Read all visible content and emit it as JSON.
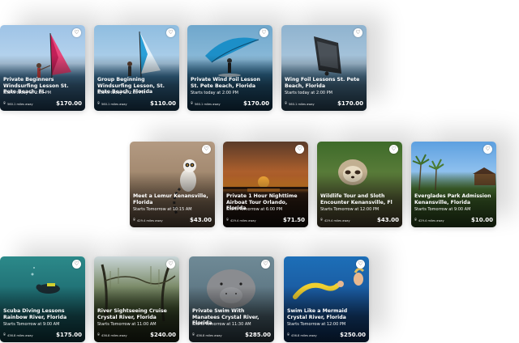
{
  "rows": [
    {
      "cards": [
        {
          "title": "Private Beginners Windsurfing Lesson St. Pete Beach, FL",
          "start": "Starts today at 2:00 PM",
          "distance": "560.1 miles away",
          "price": "$170.00",
          "image_icon": "windsurf-photo"
        },
        {
          "title": "Group Beginning Windsurfing Lesson, St. Pete Beach, Florida",
          "start": "Starts today at 2:00 PM",
          "distance": "560.1 miles away",
          "price": "$110.00",
          "image_icon": "windsurf-photo"
        },
        {
          "title": "Private Wind Foil Lesson St. Pete Beach, Florida",
          "start": "Starts today at 2:00 PM",
          "distance": "560.1 miles away",
          "price": "$170.00",
          "image_icon": "wind-foil-photo"
        },
        {
          "title": "Wing Foil Lessons St. Pete Beach, Florida",
          "start": "Starts today at 2:00 PM",
          "distance": "560.1 miles away",
          "price": "$170.00",
          "image_icon": "wing-foil-photo"
        }
      ]
    },
    {
      "cards": [
        {
          "title": "Meet a Lemur Kenansville, Florida",
          "start": "Starts Tomorrow at 10:15 AM",
          "distance": "429.4 miles away",
          "price": "$43.00",
          "image_icon": "lemur-photo"
        },
        {
          "title": "Private 1 Hour Nighttime Airboat Tour Orlando, Florida",
          "start": "Starts Tomorrow at 6:00 PM",
          "distance": "429.4 miles away",
          "price": "$71.50",
          "image_icon": "sunset-photo"
        },
        {
          "title": "Wildlife Tour and Sloth Encounter Kenansville, Fl",
          "start": "Starts Tomorrow at 12:00 PM",
          "distance": "429.4 miles away",
          "price": "$43.00",
          "image_icon": "sloth-photo"
        },
        {
          "title": "Everglades Park Admission Kenansville, Florida",
          "start": "Starts Tomorrow at 9:00 AM",
          "distance": "429.4 miles away",
          "price": "$10.00",
          "image_icon": "everglades-photo"
        }
      ]
    },
    {
      "cards": [
        {
          "title": "Scuba Diving Lessons Rainbow River, Florida",
          "start": "Starts Tomorrow at 9:00 AM",
          "distance": "436.8 miles away",
          "price": "$175.00",
          "image_icon": "scuba-photo"
        },
        {
          "title": "River Sightseeing Cruise Crystal River, Florida",
          "start": "Starts Tomorrow at 11:00 AM",
          "distance": "436.8 miles away",
          "price": "$240.00",
          "image_icon": "forest-photo"
        },
        {
          "title": "Private Swim With Manatees Crystal River, Florida",
          "start": "Starts Tomorrow at 11:30 AM",
          "distance": "436.8 miles away",
          "price": "$285.00",
          "image_icon": "manatee-photo"
        },
        {
          "title": "Swim Like a Mermaid Crystal River, Florida",
          "start": "Starts Tomorrow at 12:00 PM",
          "distance": "436.8 miles away",
          "price": "$250.00",
          "image_icon": "mermaid-photo"
        }
      ]
    }
  ]
}
